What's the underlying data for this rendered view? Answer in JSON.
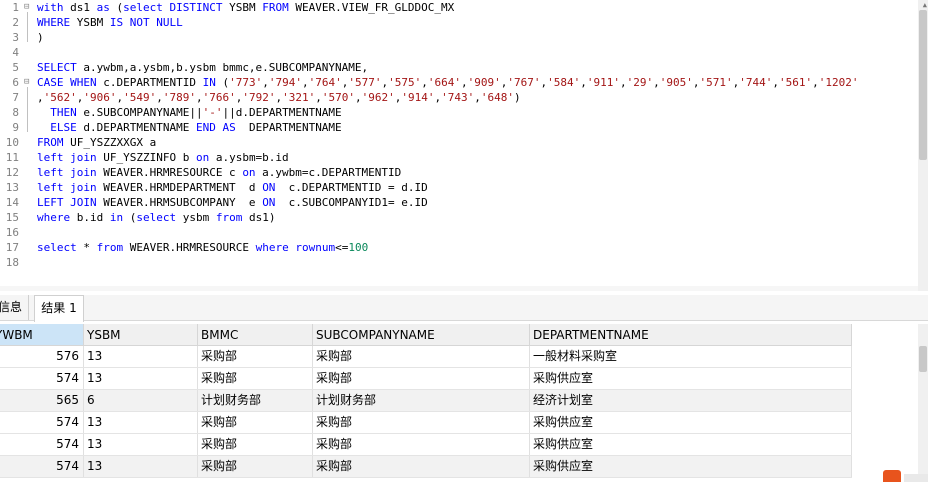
{
  "editor": {
    "line_numbers": [
      "1",
      "2",
      "3",
      "4",
      "5",
      "6",
      "7",
      "8",
      "9",
      "10",
      "11",
      "12",
      "13",
      "14",
      "15",
      "16",
      "17",
      "18"
    ],
    "lines": [
      [
        {
          "t": "with",
          "c": "kw"
        },
        {
          "t": " ds1 "
        },
        {
          "t": "as",
          "c": "kw"
        },
        {
          "t": " ("
        },
        {
          "t": "select DISTINCT",
          "c": "kw"
        },
        {
          "t": " YSBM "
        },
        {
          "t": "FROM",
          "c": "kw"
        },
        {
          "t": " WEAVER.VIEW_FR_GLDDOC_MX"
        }
      ],
      [
        {
          "t": "WHERE",
          "c": "kw"
        },
        {
          "t": " YSBM "
        },
        {
          "t": "IS NOT NULL",
          "c": "kw"
        }
      ],
      [
        {
          "t": ")"
        }
      ],
      [],
      [
        {
          "t": "SELECT",
          "c": "kw"
        },
        {
          "t": " a.ywbm,a.ysbm,b.ysbm bmmc,e.SUBCOMPANYNAME,"
        }
      ],
      [
        {
          "t": "CASE WHEN",
          "c": "kw"
        },
        {
          "t": " c.DEPARTMENTID "
        },
        {
          "t": "IN",
          "c": "kw"
        },
        {
          "t": " ("
        },
        {
          "t": "'773'",
          "c": "st"
        },
        {
          "t": ","
        },
        {
          "t": "'794'",
          "c": "st"
        },
        {
          "t": ","
        },
        {
          "t": "'764'",
          "c": "st"
        },
        {
          "t": ","
        },
        {
          "t": "'577'",
          "c": "st"
        },
        {
          "t": ","
        },
        {
          "t": "'575'",
          "c": "st"
        },
        {
          "t": ","
        },
        {
          "t": "'664'",
          "c": "st"
        },
        {
          "t": ","
        },
        {
          "t": "'909'",
          "c": "st"
        },
        {
          "t": ","
        },
        {
          "t": "'767'",
          "c": "st"
        },
        {
          "t": ","
        },
        {
          "t": "'584'",
          "c": "st"
        },
        {
          "t": ","
        },
        {
          "t": "'911'",
          "c": "st"
        },
        {
          "t": ","
        },
        {
          "t": "'29'",
          "c": "st"
        },
        {
          "t": ","
        },
        {
          "t": "'905'",
          "c": "st"
        },
        {
          "t": ","
        },
        {
          "t": "'571'",
          "c": "st"
        },
        {
          "t": ","
        },
        {
          "t": "'744'",
          "c": "st"
        },
        {
          "t": ","
        },
        {
          "t": "'561'",
          "c": "st"
        },
        {
          "t": ","
        },
        {
          "t": "'1202'",
          "c": "st"
        }
      ],
      [
        {
          "t": ","
        },
        {
          "t": "'562'",
          "c": "st"
        },
        {
          "t": ","
        },
        {
          "t": "'906'",
          "c": "st"
        },
        {
          "t": ","
        },
        {
          "t": "'549'",
          "c": "st"
        },
        {
          "t": ","
        },
        {
          "t": "'789'",
          "c": "st"
        },
        {
          "t": ","
        },
        {
          "t": "'766'",
          "c": "st"
        },
        {
          "t": ","
        },
        {
          "t": "'792'",
          "c": "st"
        },
        {
          "t": ","
        },
        {
          "t": "'321'",
          "c": "st"
        },
        {
          "t": ","
        },
        {
          "t": "'570'",
          "c": "st"
        },
        {
          "t": ","
        },
        {
          "t": "'962'",
          "c": "st"
        },
        {
          "t": ","
        },
        {
          "t": "'914'",
          "c": "st"
        },
        {
          "t": ","
        },
        {
          "t": "'743'",
          "c": "st"
        },
        {
          "t": ","
        },
        {
          "t": "'648'",
          "c": "st"
        },
        {
          "t": ")"
        }
      ],
      [
        {
          "t": "  "
        },
        {
          "t": "THEN",
          "c": "kw"
        },
        {
          "t": " e.SUBCOMPANYNAME||"
        },
        {
          "t": "'-'",
          "c": "st"
        },
        {
          "t": "||d.DEPARTMENTNAME"
        }
      ],
      [
        {
          "t": "  "
        },
        {
          "t": "ELSE",
          "c": "kw"
        },
        {
          "t": " d.DEPARTMENTNAME "
        },
        {
          "t": "END AS",
          "c": "kw"
        },
        {
          "t": "  DEPARTMENTNAME"
        }
      ],
      [
        {
          "t": "FROM",
          "c": "kw"
        },
        {
          "t": " UF_YSZZXXGX a"
        }
      ],
      [
        {
          "t": "left join",
          "c": "kw"
        },
        {
          "t": " UF_YSZZINFO b "
        },
        {
          "t": "on",
          "c": "kw"
        },
        {
          "t": " a.ysbm=b.id"
        }
      ],
      [
        {
          "t": "left join",
          "c": "kw"
        },
        {
          "t": " WEAVER.HRMRESOURCE c "
        },
        {
          "t": "on",
          "c": "kw"
        },
        {
          "t": " a.ywbm=c.DEPARTMENTID"
        }
      ],
      [
        {
          "t": "left join",
          "c": "kw"
        },
        {
          "t": " WEAVER.HRMDEPARTMENT  d "
        },
        {
          "t": "ON",
          "c": "kw"
        },
        {
          "t": "  c.DEPARTMENTID = d.ID"
        }
      ],
      [
        {
          "t": "LEFT JOIN",
          "c": "kw"
        },
        {
          "t": " WEAVER.HRMSUBCOMPANY  e "
        },
        {
          "t": "ON",
          "c": "kw"
        },
        {
          "t": "  c.SUBCOMPANYID1= e.ID"
        }
      ],
      [
        {
          "t": "where",
          "c": "kw"
        },
        {
          "t": " b.id "
        },
        {
          "t": "in",
          "c": "kw"
        },
        {
          "t": " ("
        },
        {
          "t": "select",
          "c": "kw"
        },
        {
          "t": " ysbm "
        },
        {
          "t": "from",
          "c": "kw"
        },
        {
          "t": " ds1)"
        }
      ],
      [],
      [
        {
          "t": "select",
          "c": "kw"
        },
        {
          "t": " * "
        },
        {
          "t": "from",
          "c": "kw"
        },
        {
          "t": " WEAVER.HRMRESOURCE "
        },
        {
          "t": "where",
          "c": "kw"
        },
        {
          "t": " "
        },
        {
          "t": "rownum",
          "c": "kw"
        },
        {
          "t": "<="
        },
        {
          "t": "100",
          "c": "nm"
        }
      ],
      []
    ]
  },
  "result_tabs": {
    "info": "信息",
    "result": "结果 1"
  },
  "grid": {
    "columns": [
      "YWBM",
      "YSBM",
      "BMMC",
      "SUBCOMPANYNAME",
      "DEPARTMENTNAME"
    ],
    "rows": [
      [
        "576",
        "13",
        "采购部",
        "采购部",
        "一般材料采购室"
      ],
      [
        "574",
        "13",
        "采购部",
        "采购部",
        "采购供应室"
      ],
      [
        "565",
        "6",
        "计划财务部",
        "计划财务部",
        "经济计划室"
      ],
      [
        "574",
        "13",
        "采购部",
        "采购部",
        "采购供应室"
      ],
      [
        "574",
        "13",
        "采购部",
        "采购部",
        "采购供应室"
      ],
      [
        "574",
        "13",
        "采购部",
        "采购部",
        "采购供应室"
      ]
    ]
  },
  "colors": {
    "keyword": "#0000ff",
    "string": "#a31515",
    "number": "#09885a",
    "header_selected": "#cce4f7"
  }
}
